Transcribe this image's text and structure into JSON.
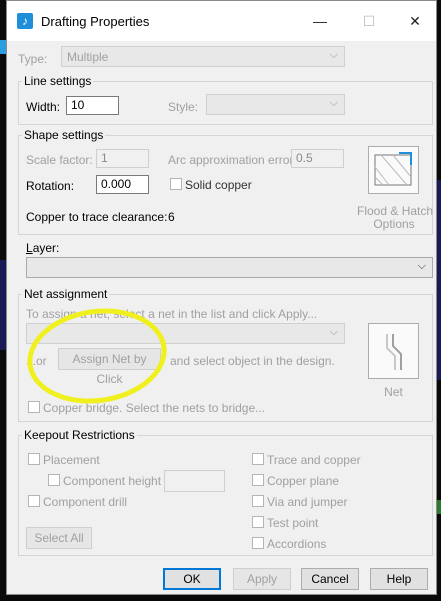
{
  "window": {
    "title": "Drafting Properties",
    "minimize": "—",
    "maximize": "☐",
    "close": "✕",
    "icon": "drafting-app-icon"
  },
  "type_row": {
    "label": "Type:",
    "value": "Multiple"
  },
  "line_settings": {
    "label": "Line settings",
    "width_label": "Width:",
    "width_value": "10",
    "style_label": "Style:",
    "style_value": ""
  },
  "shape_settings": {
    "label": "Shape settings",
    "scale_label": "Scale factor:",
    "scale_value": "1",
    "arc_label": "Arc approximation error:",
    "arc_value": "0.5",
    "rotation_label": "Rotation:",
    "rotation_value": "0.000",
    "solid_copper_label": "Solid copper",
    "clearance_label": "Copper to trace clearance:",
    "clearance_value": "6",
    "flood_button_label_line1": "Flood & Hatch",
    "flood_button_label_line2": "Options"
  },
  "layer": {
    "label": "Layer:",
    "value": ""
  },
  "net_assignment": {
    "label": "Net assignment",
    "instruction": "To assign a net, select a net in the list and click Apply...",
    "or_label": "...or",
    "assign_button": "Assign Net by Click",
    "after_text": "and select object in the design.",
    "net_button_label": "Net",
    "bridge_label": "Copper bridge. Select the nets to bridge..."
  },
  "keepout": {
    "label": "Keepout Restrictions",
    "left_items": [
      "Placement",
      "Component height",
      "Component drill"
    ],
    "right_items": [
      "Trace and copper",
      "Copper plane",
      "Via and jumper",
      "Test point",
      "Accordions"
    ],
    "height_value": "",
    "select_all": "Select All"
  },
  "buttons": {
    "ok": "OK",
    "apply": "Apply",
    "cancel": "Cancel",
    "help": "Help"
  },
  "colors": {
    "accent": "#0078d7",
    "highlight": "#f0f01e",
    "icon": "#1e8fd8"
  }
}
